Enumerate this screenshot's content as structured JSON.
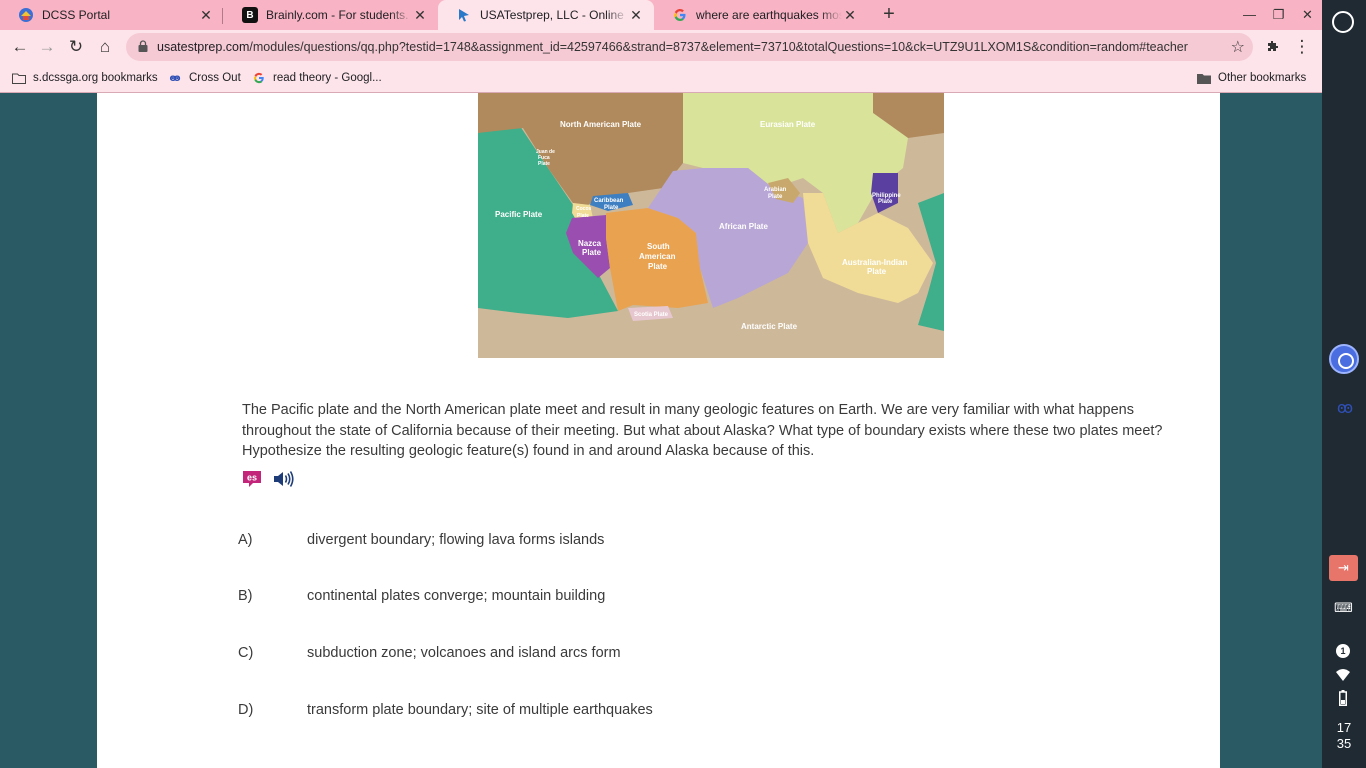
{
  "tabs": [
    {
      "title": "DCSS Portal",
      "active": false
    },
    {
      "title": "Brainly.com - For students. By students.",
      "active": false
    },
    {
      "title": "USATestprep, LLC - Online State-Specific",
      "active": true
    },
    {
      "title": "where are earthquakes most likely",
      "active": false
    }
  ],
  "address_bar": {
    "domain": "usatestprep.com",
    "path": "/modules/questions/qq.php?testid=1748&assignment_id=42597466&strand=8737&element=73710&totalQuestions=10&ck=UTZ9U1LXOM1S&condition=random#teacher"
  },
  "bookmarks": [
    {
      "label": "s.dcssga.org bookmarks",
      "icon": "folder-icon"
    },
    {
      "label": "Cross Out",
      "icon": "owl-icon"
    },
    {
      "label": "read theory - Googl...",
      "icon": "google-icon"
    }
  ],
  "other_bookmarks": "Other bookmarks",
  "map": {
    "labels": {
      "north_american": "North American Plate",
      "eurasian": "Eurasian Plate",
      "juan_de_fuca_1": "Juan de",
      "juan_de_fuca_2": "Fuca",
      "juan_de_fuca_3": "Plate",
      "caribbean_1": "Caribbean",
      "caribbean_2": "Plate",
      "cocos_1": "Cocos",
      "cocos_2": "Plate",
      "arabian_1": "Arabian",
      "arabian_2": "Plate",
      "philippine_1": "Philippine",
      "philippine_2": "Plate",
      "pacific": "Pacific Plate",
      "nazca_1": "Nazca",
      "nazca_2": "Plate",
      "south_american_1": "South",
      "south_american_2": "American",
      "south_american_3": "Plate",
      "african": "African Plate",
      "australian_1": "Australian-Indian",
      "australian_2": "Plate",
      "scotia": "Scotia Plate",
      "antarctic": "Antarctic Plate"
    },
    "colors": {
      "north_american": "#b08a5c",
      "eurasian": "#d9e49a",
      "pacific": "#3fae8a",
      "nazca": "#9a4fb0",
      "south_american": "#e9a24f",
      "african": "#b8a6d6",
      "australian": "#f1dc97",
      "antarctic": "#cdb89a",
      "philippine": "#5a3fa0",
      "caribbean": "#3d7fc0"
    }
  },
  "question": {
    "text": "The Pacific plate and the North American plate meet and result in many geologic features on Earth. We are very familiar with what happens throughout the state of California because of their meeting. But what about Alaska? What type of boundary exists where these two plates meet? Hypothesize the resulting geologic feature(s) found in and around Alaska because of this.",
    "es_icon_label": "es",
    "choices": [
      {
        "letter": "A)",
        "text": "divergent boundary; flowing lava forms islands"
      },
      {
        "letter": "B)",
        "text": "continental plates converge; mountain building"
      },
      {
        "letter": "C)",
        "text": "subduction zone; volcanoes and island arcs form"
      },
      {
        "letter": "D)",
        "text": "transform plate boundary; site of multiple earthquakes"
      }
    ]
  },
  "shelf": {
    "notification_count": "1",
    "clock_hour": "17",
    "clock_minute": "35"
  }
}
